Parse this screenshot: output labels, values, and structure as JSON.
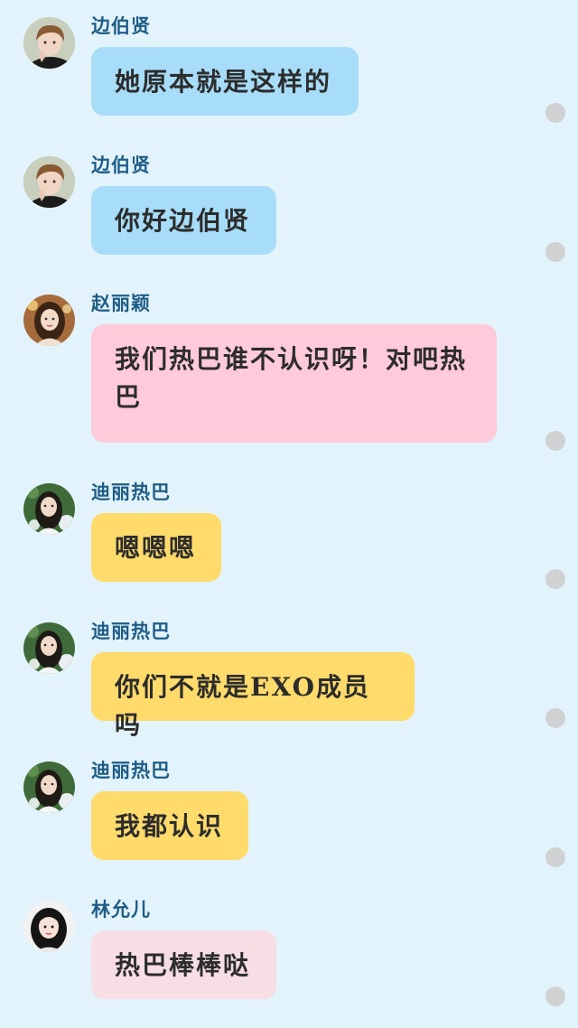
{
  "messages": [
    {
      "sender": "边伯贤",
      "text": "她原本就是这样的",
      "color": "#a7ddf8",
      "avatar_icon": "avatar-boy-icon"
    },
    {
      "sender": "边伯贤",
      "text": "你好边伯贤",
      "color": "#a7ddf8",
      "avatar_icon": "avatar-boy-icon"
    },
    {
      "sender": "赵丽颖",
      "text": "我们热巴谁不认识呀！对吧热巴",
      "color": "#ffcad9",
      "avatar_icon": "avatar-woman-icon"
    },
    {
      "sender": "迪丽热巴",
      "text": "嗯嗯嗯",
      "color": "#ffdb6b",
      "avatar_icon": "avatar-woman-flower-icon"
    },
    {
      "sender": "迪丽热巴",
      "text": "你们不就是EXO成员吗",
      "color": "#ffdb6b",
      "avatar_icon": "avatar-woman-flower-icon"
    },
    {
      "sender": "迪丽热巴",
      "text": "我都认识",
      "color": "#ffdb6b",
      "avatar_icon": "avatar-woman-flower-icon"
    },
    {
      "sender": "林允儿",
      "text": "热巴棒棒哒",
      "color": "#f7dde4",
      "avatar_icon": "avatar-girl-icon"
    }
  ],
  "colors": {
    "background": "#e2f3fb",
    "sender_name": "#1f5d86",
    "status_dot": "#cfd1d3"
  }
}
